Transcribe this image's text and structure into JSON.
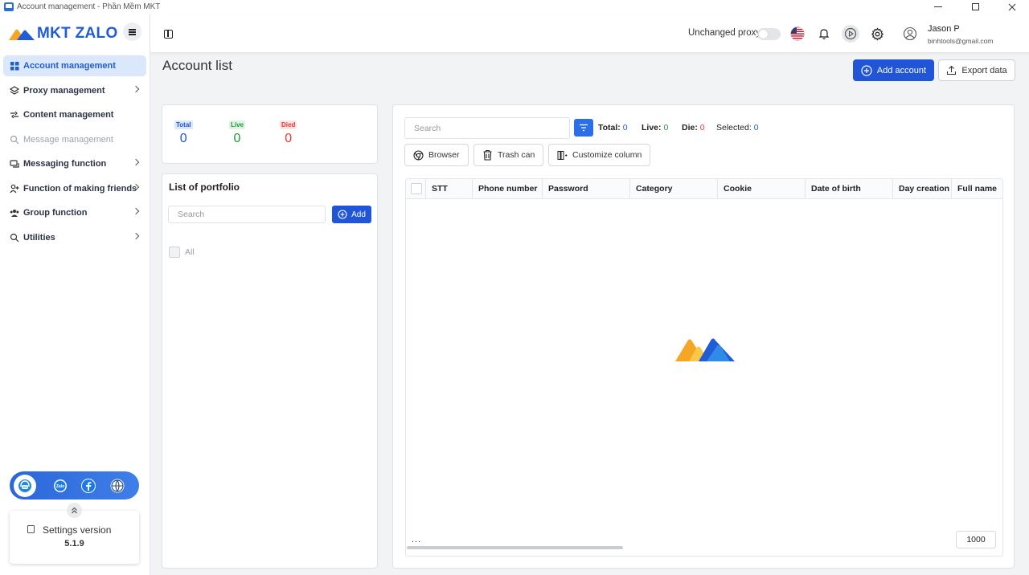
{
  "window": {
    "title": "Account management - Phần Mềm MKT"
  },
  "sidebar": {
    "brand": "MKT ZALO",
    "items": [
      {
        "label": "Account management",
        "icon": "grid-icon"
      },
      {
        "label": "Proxy management",
        "icon": "layers-icon"
      },
      {
        "label": "Content management",
        "icon": "link-icon"
      },
      {
        "label": "Message management",
        "icon": "search-icon"
      },
      {
        "label": "Messaging function",
        "icon": "message-icon"
      },
      {
        "label": "Function of making friends",
        "icon": "user-plus-icon"
      },
      {
        "label": "Group function",
        "icon": "group-icon"
      },
      {
        "label": "Utilities",
        "icon": "search-icon"
      }
    ],
    "settings_label": "Settings version",
    "version": "5.1.9"
  },
  "header": {
    "proxy_label": "Unchanged proxy",
    "user_name": "Jason P",
    "user_email": "binhtools@gmail.com"
  },
  "main": {
    "title": "Account list",
    "add_account_label": "Add account",
    "export_label": "Export data"
  },
  "stats": {
    "total_label": "Total",
    "total_value": "0",
    "live_label": "Live",
    "live_value": "0",
    "died_label": "Died",
    "died_value": "0"
  },
  "portfolio": {
    "title": "List of portfolio",
    "search_placeholder": "Search",
    "add_label": "Add",
    "all_label": "All"
  },
  "accounts": {
    "search_placeholder": "Search",
    "total_label": "Total:",
    "total_value": "0",
    "live_label": "Live:",
    "live_value": "0",
    "die_label": "Die:",
    "die_value": "0",
    "selected_label": "Selected:",
    "selected_value": "0",
    "browser_label": "Browser",
    "trash_label": "Trash can",
    "customize_label": "Customize column",
    "columns": [
      "STT",
      "Phone number",
      "Password",
      "Category",
      "Cookie",
      "Date of birth",
      "Day creation",
      "Full name"
    ],
    "footer_dots": "...",
    "page_size": "1000"
  },
  "colors": {
    "accent": "#1f55d6",
    "live": "#1e9b3a",
    "died": "#e53935",
    "link_blue": "#2b6fe8"
  }
}
